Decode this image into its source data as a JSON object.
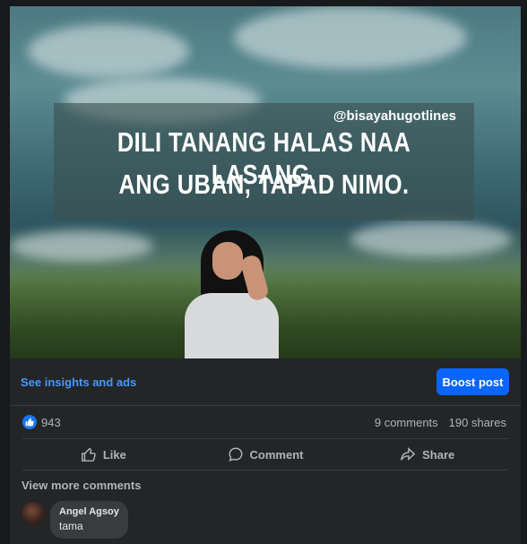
{
  "photo": {
    "handle": "@bisayahugotlines",
    "quote_line1": "DILI TANANG HALAS NAA LASANG.",
    "quote_line2": "ANG UBAN, TAPAD NIMO."
  },
  "insights": {
    "link": "See insights and ads",
    "boost": "Boost post"
  },
  "stats": {
    "likes": "943",
    "comments": "9 comments",
    "shares": "190 shares"
  },
  "actions": {
    "like": "Like",
    "comment": "Comment",
    "share": "Share"
  },
  "comments": {
    "view_more": "View more comments",
    "items": [
      {
        "name": "Angel Agsoy",
        "text": "tama"
      }
    ]
  },
  "colors": {
    "accent": "#0866ff",
    "link": "#4599ff",
    "card": "#242526",
    "page": "#18191a"
  },
  "icons": [
    "like-reaction-icon",
    "thumbs-up-icon",
    "comment-icon",
    "share-icon"
  ]
}
